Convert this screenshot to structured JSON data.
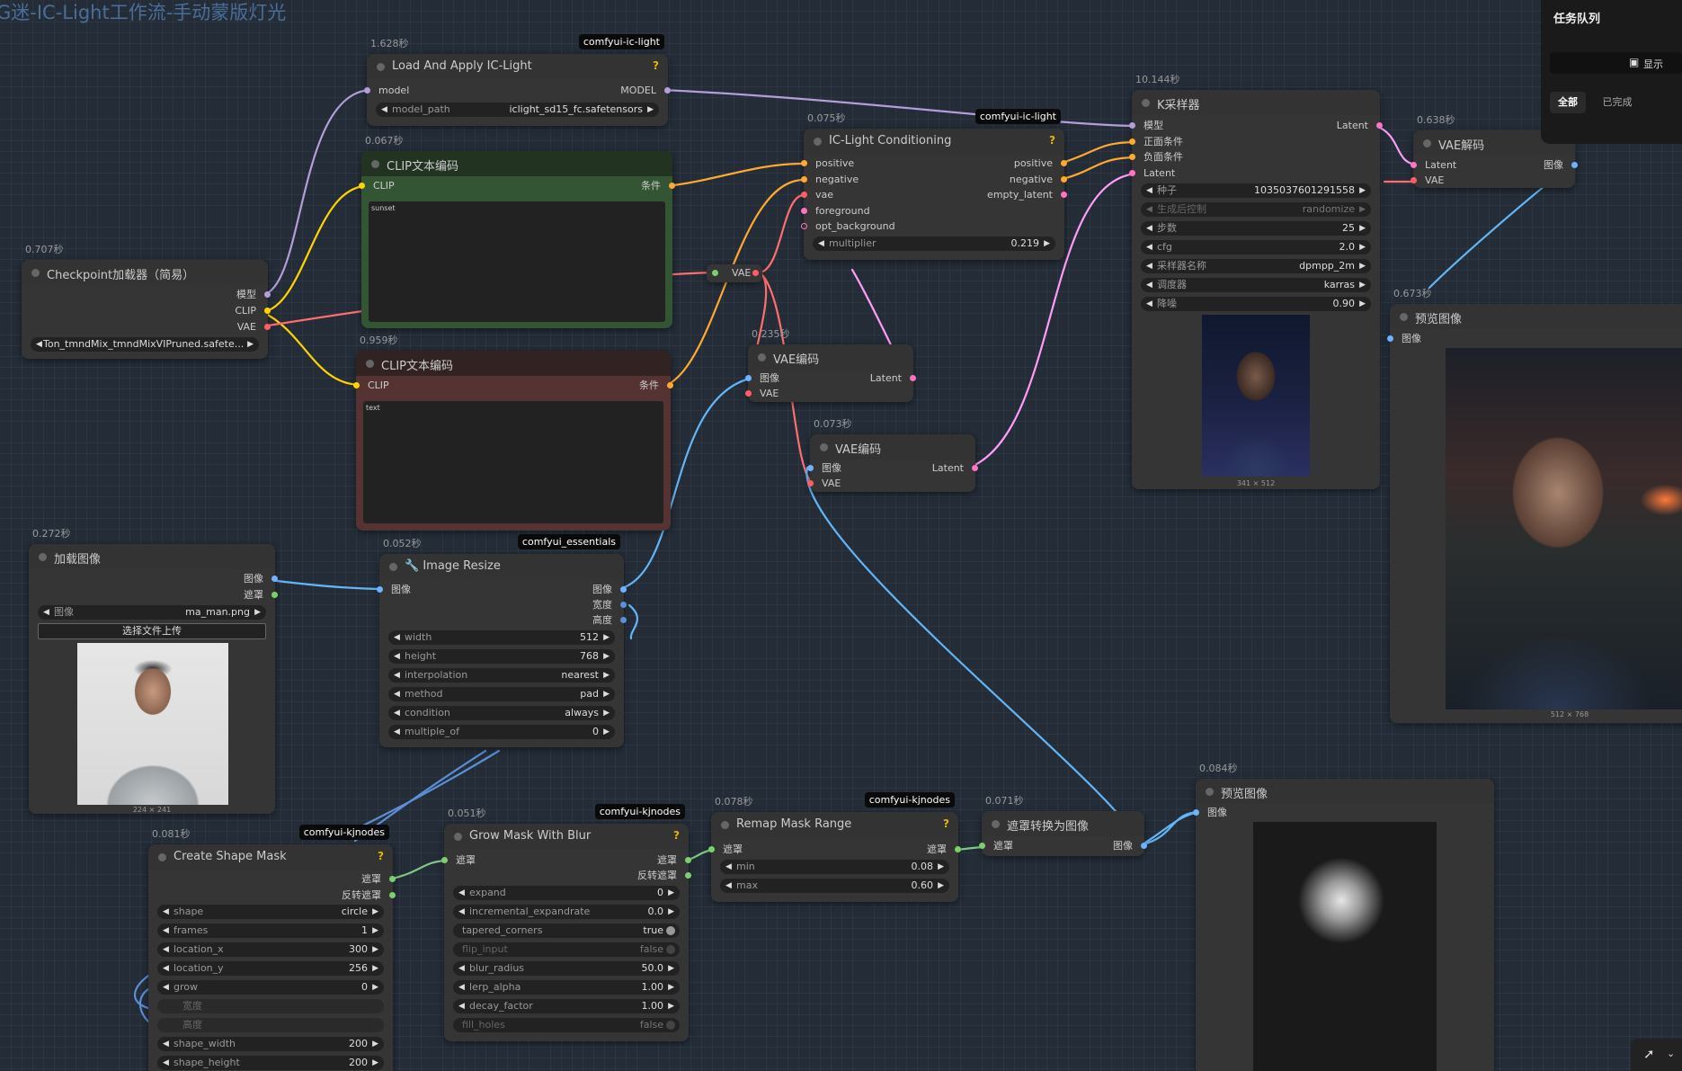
{
  "workflow_title": "G迷-IC-Light工作流-手动蒙版灯光",
  "queue_panel": {
    "title": "任务队列",
    "show_label": "显示",
    "tab_all": "全部",
    "tab_done": "已完成"
  },
  "nodes": {
    "load_ic": {
      "time": "1.628秒",
      "badge": "comfyui-ic-light",
      "title": "Load And Apply IC-Light",
      "in_model": "model",
      "out_model": "MODEL",
      "w_model_path_label": "model_path",
      "w_model_path_value": "iclight_sd15_fc.safetensors"
    },
    "clip_pos": {
      "time": "0.067秒",
      "title": "CLIP文本编码",
      "in_clip": "CLIP",
      "out_cond": "条件",
      "text": "sunset"
    },
    "clip_neg": {
      "time": "0.959秒",
      "title": "CLIP文本编码",
      "in_clip": "CLIP",
      "out_cond": "条件",
      "text": "text"
    },
    "checkpoint": {
      "time": "0.707秒",
      "title": "Checkpoint加载器（简易）",
      "out_model": "模型",
      "out_clip": "CLIP",
      "out_vae": "VAE",
      "ckpt_value": "Ton_tmndMix_tmndMixVIPruned.safete..."
    },
    "ic_cond": {
      "time": "0.075秒",
      "badge": "comfyui-ic-light",
      "title": "IC-Light Conditioning",
      "in_positive": "positive",
      "in_negative": "negative",
      "in_vae": "vae",
      "in_foreground": "foreground",
      "in_opt_bg": "opt_background",
      "out_positive": "positive",
      "out_negative": "negative",
      "out_empty": "empty_latent",
      "w_multiplier_label": "multiplier",
      "w_multiplier_value": "0.219"
    },
    "reroute_vae": {
      "label": "VAE"
    },
    "ksampler": {
      "time": "10.144秒",
      "title": "K采样器",
      "in_model": "模型",
      "in_pos": "正面条件",
      "in_neg": "负面条件",
      "in_latent": "Latent",
      "out_latent": "Latent",
      "widgets": [
        {
          "label": "种子",
          "value": "1035037601291558"
        },
        {
          "label": "生成后控制",
          "value": "randomize"
        },
        {
          "label": "步数",
          "value": "25"
        },
        {
          "label": "cfg",
          "value": "2.0"
        },
        {
          "label": "采样器名称",
          "value": "dpmpp_2m"
        },
        {
          "label": "调度器",
          "value": "karras"
        },
        {
          "label": "降噪",
          "value": "0.90"
        }
      ],
      "dims": "341 × 512"
    },
    "vae_decode": {
      "time": "0.638秒",
      "title": "VAE解码",
      "in_latent": "Latent",
      "in_vae": "VAE",
      "out_image": "图像"
    },
    "preview1": {
      "time": "0.673秒",
      "title": "预览图像",
      "in_image": "图像",
      "dims": "512 × 768"
    },
    "vae_enc1": {
      "time": "0.235秒",
      "title": "VAE编码",
      "in_image": "图像",
      "in_vae": "VAE",
      "out_latent": "Latent"
    },
    "vae_enc2": {
      "time": "0.073秒",
      "title": "VAE编码",
      "in_image": "图像",
      "in_vae": "VAE",
      "out_latent": "Latent"
    },
    "load_image": {
      "time": "0.272秒",
      "title": "加载图像",
      "out_image": "图像",
      "out_mask": "遮罩",
      "w_image_label": "图像",
      "w_image_value": "ma_man.png",
      "upload": "选择文件上传",
      "dims": "224 × 241"
    },
    "resize": {
      "time": "0.052秒",
      "badge": "comfyui_essentials",
      "title": "Image Resize",
      "in_image": "图像",
      "out_image": "图像",
      "out_width": "宽度",
      "out_height": "高度",
      "widgets": [
        {
          "label": "width",
          "value": "512"
        },
        {
          "label": "height",
          "value": "768"
        },
        {
          "label": "interpolation",
          "value": "nearest"
        },
        {
          "label": "method",
          "value": "pad"
        },
        {
          "label": "condition",
          "value": "always"
        },
        {
          "label": "multiple_of",
          "value": "0"
        }
      ]
    },
    "shape_mask": {
      "time": "0.081秒",
      "badge": "comfyui-kjnodes",
      "title": "Create Shape Mask",
      "out_mask": "遮罩",
      "out_inv": "反转遮罩",
      "widgets": [
        {
          "label": "shape",
          "value": "circle"
        },
        {
          "label": "frames",
          "value": "1"
        },
        {
          "label": "location_x",
          "value": "300"
        },
        {
          "label": "location_y",
          "value": "256"
        },
        {
          "label": "grow",
          "value": "0"
        }
      ],
      "in_width": "宽度",
      "in_height": "高度",
      "widgets2": [
        {
          "label": "shape_width",
          "value": "200"
        },
        {
          "label": "shape_height",
          "value": "200"
        }
      ]
    },
    "grow_mask": {
      "time": "0.051秒",
      "badge": "comfyui-kjnodes",
      "title": "Grow Mask With Blur",
      "in_mask": "遮罩",
      "out_mask": "遮罩",
      "out_inv": "反转遮罩",
      "widgets": [
        {
          "label": "expand",
          "value": "0"
        },
        {
          "label": "incremental_expandrate",
          "value": "0.0"
        },
        {
          "label": "tapered_corners",
          "value": "true"
        },
        {
          "label": "flip_input",
          "value": "false"
        },
        {
          "label": "blur_radius",
          "value": "50.0"
        },
        {
          "label": "lerp_alpha",
          "value": "1.00"
        },
        {
          "label": "decay_factor",
          "value": "1.00"
        },
        {
          "label": "fill_holes",
          "value": "false"
        }
      ]
    },
    "remap": {
      "time": "0.078秒",
      "badge": "comfyui-kjnodes",
      "title": "Remap Mask Range",
      "in_mask": "遮罩",
      "out_mask": "遮罩",
      "widgets": [
        {
          "label": "min",
          "value": "0.08"
        },
        {
          "label": "max",
          "value": "0.60"
        }
      ]
    },
    "mask_to_img": {
      "time": "0.071秒",
      "title": "遮罩转换为图像",
      "in_mask": "遮罩",
      "out_image": "图像"
    },
    "preview2": {
      "time": "0.084秒",
      "title": "预览图像",
      "in_image": "图像"
    }
  },
  "colors": {
    "model": "#b39ddb",
    "clip": "#ffd500",
    "vae": "#ff6e6e",
    "conditioning": "#ffa931",
    "latent": "#ff9cf9",
    "image": "#64b5f6",
    "mask": "#81c784"
  }
}
